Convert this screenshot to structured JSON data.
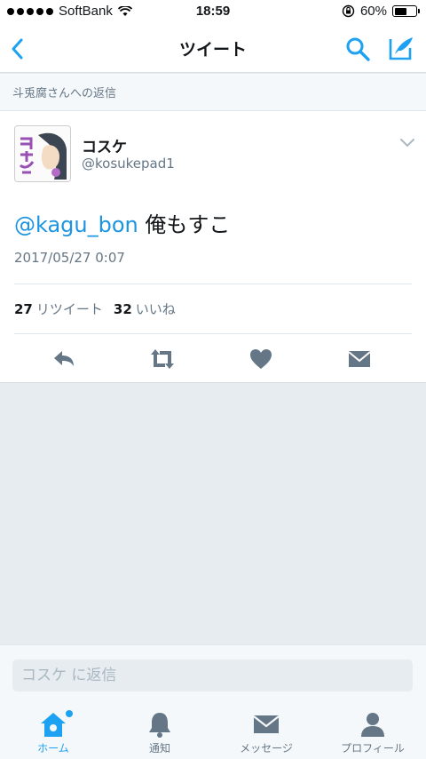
{
  "status_bar": {
    "carrier": "SoftBank",
    "time": "18:59",
    "battery_text": "60%",
    "battery_level": 0.6
  },
  "nav": {
    "title": "ツイート",
    "back_icon": "chevron-left-icon",
    "search_icon": "search-icon",
    "compose_icon": "compose-icon"
  },
  "reply_context": "斗兎腐さんへの返信",
  "tweet": {
    "display_name": "コスケ",
    "screen_name": "@kosukepad1",
    "mention": "@kagu_bon",
    "text": " 俺もすこ",
    "timestamp": "2017/05/27 0:07",
    "retweet_count": "27",
    "retweet_label": "リツイート",
    "like_count": "32",
    "like_label": "いいね"
  },
  "reply_box": {
    "placeholder": "コスケ に返信"
  },
  "tabs": [
    {
      "label": "ホーム",
      "icon": "home-icon",
      "active": true
    },
    {
      "label": "通知",
      "icon": "bell-icon"
    },
    {
      "label": "メッセージ",
      "icon": "envelope-icon"
    },
    {
      "label": "プロフィール",
      "icon": "person-icon"
    }
  ],
  "colors": {
    "accent": "#1da1f2",
    "icon_gray": "#657786",
    "background": "#e6ecf0"
  }
}
